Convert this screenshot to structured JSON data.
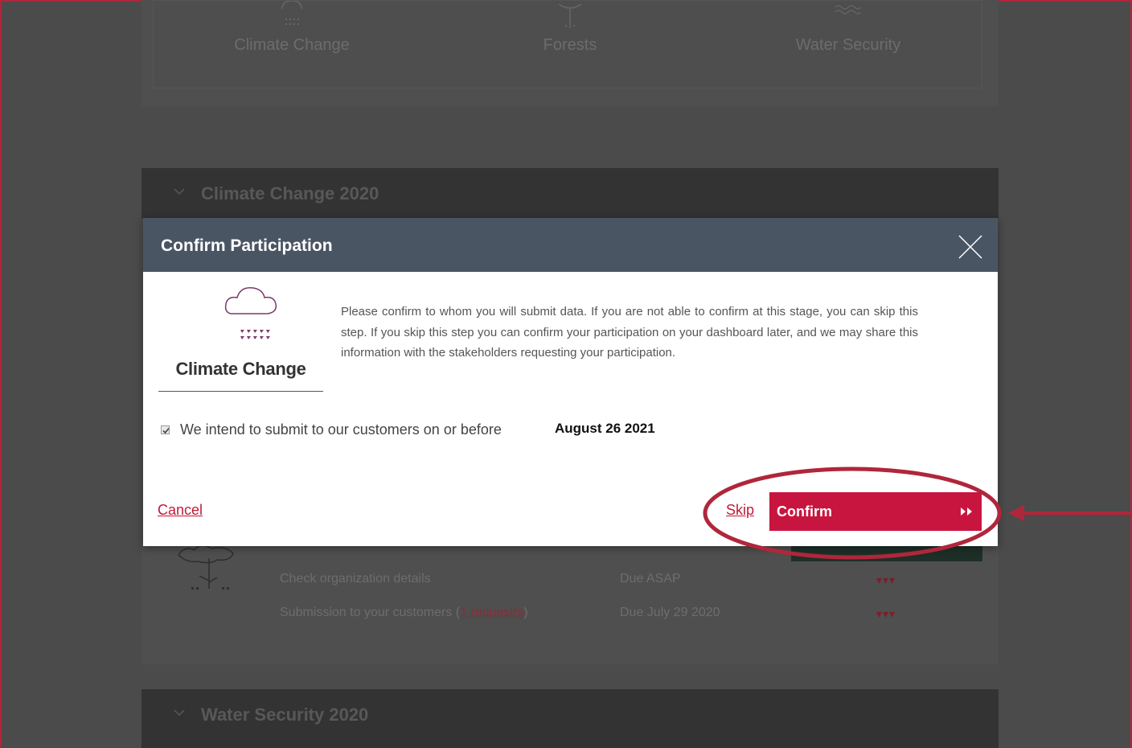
{
  "background": {
    "topics": [
      "Climate Change",
      "Forests",
      "Water Security"
    ],
    "sections": [
      {
        "title": "Climate Change 2020"
      },
      {
        "title": "Water Security 2020"
      }
    ],
    "rows": [
      {
        "task": "Check organization details",
        "due": "Due ASAP"
      },
      {
        "task_prefix": "Submission to your customers (",
        "task_link": "1 request/s",
        "task_suffix": ")",
        "due": "Due July 29 2020"
      }
    ]
  },
  "modal": {
    "title": "Confirm Participation",
    "topic_label": "Climate Change",
    "message": "Please confirm to whom you will submit data. If you are not able to confirm at this stage, you can skip this step. If you skip this step you can confirm your participation on your dashboard later, and we may share this information with the stakeholders requesting your participation.",
    "intent_checked": true,
    "intent_label": "We intend to submit to our customers on or before",
    "intent_date": "August 26 2021",
    "cancel_label": "Cancel",
    "skip_label": "Skip",
    "confirm_label": "Confirm"
  },
  "colors": {
    "header": "#4a5564",
    "accent": "#c8153f",
    "annotation": "#b0263b",
    "overlay": "#4b4b4b"
  },
  "icons": [
    "cloud-rain-icon",
    "close-icon",
    "double-chevron-right-icon",
    "chevron-down-icon",
    "tree-icon",
    "waves-icon"
  ]
}
